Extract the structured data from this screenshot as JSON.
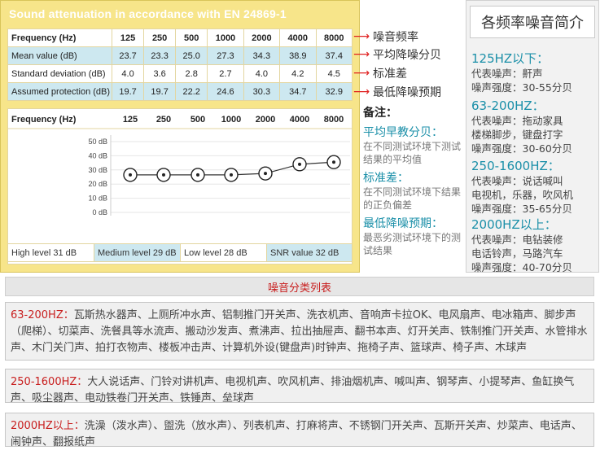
{
  "attenuation": {
    "title": "Sound attenuation in accordance with  EN 24869-1",
    "table": {
      "header_label": "Frequency (Hz)",
      "frequencies": [
        "125",
        "250",
        "500",
        "1000",
        "2000",
        "4000",
        "8000"
      ],
      "rows": [
        {
          "label": "Mean value (dB)",
          "values": [
            "23.7",
            "23.3",
            "25.0",
            "27.3",
            "34.3",
            "38.9",
            "37.4"
          ],
          "note": "平均降噪分贝"
        },
        {
          "label": "Standard deviation (dB)",
          "values": [
            "4.0",
            "3.6",
            "2.8",
            "2.7",
            "4.0",
            "4.2",
            "4.5"
          ],
          "note": "标准差"
        },
        {
          "label": "Assumed protection (dB)",
          "values": [
            "19.7",
            "19.7",
            "22.2",
            "24.6",
            "30.3",
            "34.7",
            "32.9"
          ],
          "note": "最低降噪预期"
        }
      ],
      "header_note": "噪音频率"
    },
    "levels": [
      "High level 31 dB",
      "Medium level 29 dB",
      "Low level 28 dB",
      "SNR value 32 dB"
    ]
  },
  "chart_data": {
    "type": "line",
    "xlabel": "Frequency (Hz)",
    "categories": [
      "125",
      "250",
      "500",
      "1000",
      "2000",
      "4000",
      "8000"
    ],
    "y_ticks": [
      "50 dB",
      "40 dB",
      "30 dB",
      "20 dB",
      "10 dB",
      "0 dB"
    ],
    "ylim": [
      0,
      50
    ],
    "series": [
      {
        "values": [
          26.5,
          26.5,
          26.5,
          26.5,
          27.5,
          34.0,
          35.5
        ]
      }
    ],
    "marker": "circle-dot",
    "line_color": "#333333"
  },
  "notes": {
    "title": "备注：",
    "items": [
      {
        "term": "平均早教分贝：",
        "desc": "在不同测试环境下测试结果的平均值"
      },
      {
        "term": "标准差：",
        "desc": "在不同测试环境下结果的正负偏差"
      },
      {
        "term": "最低降噪预期：",
        "desc": "最恶劣测试环境下的测试结果"
      }
    ]
  },
  "freq_panel": {
    "title": "各频率噪音简介",
    "blocks": [
      {
        "head": "125HZ以下：",
        "lines": [
          "代表噪声：鼾声",
          "噪声强度：30-55分贝"
        ]
      },
      {
        "head": "63-200HZ：",
        "lines": [
          "代表噪声：拖动家具",
          "楼梯脚步，键盘打字",
          "噪声强度：30-60分贝"
        ]
      },
      {
        "head": "250-1600HZ：",
        "lines": [
          "代表噪声：说话喊叫",
          "电视机，乐器，吹风机",
          "噪声强度：35-65分贝"
        ]
      },
      {
        "head": "2000HZ以上：",
        "lines": [
          "代表噪声：电钻装修",
          "电话铃声，马路汽车",
          "噪声强度：40-70分贝"
        ]
      }
    ]
  },
  "classification": {
    "title": "噪音分类列表",
    "categories": [
      {
        "name": "63-200HZ：",
        "items": "瓦斯热水器声、上厕所冲水声、铝制推门开关声、洗衣机声、音响声卡拉OK、电风扇声、电冰箱声、脚步声（爬梯）、切菜声、洗餐具等水流声、搬动沙发声、煮沸声、拉出抽屉声、翻书本声、灯开关声、铁制推门开关声、水管排水声、木门关门声、拍打衣物声、楼板冲击声、计算机外设(键盘声)时钟声、拖椅子声、篮球声、椅子声、木球声"
      },
      {
        "name": "250-1600HZ：",
        "items": "大人说话声、门铃对讲机声、电视机声、吹风机声、排油烟机声、喊叫声、钢琴声、小提琴声、鱼缸换气声、吸尘器声、电动铁卷门开关声、铁锤声、垒球声"
      },
      {
        "name": "2000HZ以上：",
        "items": "洗澡（泼水声）、盥洗（放水声）、列表机声、打麻将声、不锈钢门开关声、瓦斯开关声、炒菜声、电话声、闹钟声、翻报纸声"
      }
    ]
  },
  "colors": {
    "panel_yellow": "#f7e58a",
    "row_blue": "#cde8f0",
    "accent_teal": "#1a8fa8",
    "accent_red": "#c81e1e",
    "arrow_red": "#e02020"
  }
}
